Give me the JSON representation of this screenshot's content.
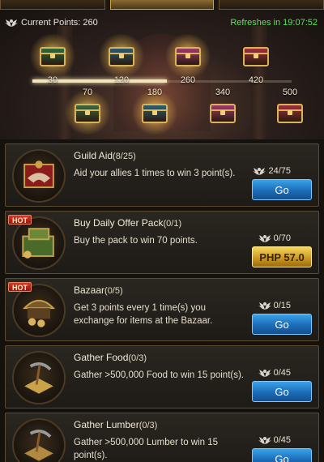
{
  "header": {
    "current_points_label": "Current Points: 260",
    "refresh_label": "Refreshes in 19:07:52"
  },
  "progress": {
    "current": 260,
    "max": 500
  },
  "milestones": [
    {
      "points": "30",
      "color": "#2f6a3a"
    },
    {
      "points": "70",
      "color": "#3a6a40"
    },
    {
      "points": "120",
      "color": "#2a5a70"
    },
    {
      "points": "180",
      "color": "#2a6070"
    },
    {
      "points": "260",
      "color": "#a03a6a"
    },
    {
      "points": "340",
      "color": "#a03a6a"
    },
    {
      "points": "420",
      "color": "#a0303a"
    },
    {
      "points": "500",
      "color": "#a0303a"
    }
  ],
  "tasks": [
    {
      "title": "Guild Aid",
      "count": "(8/25)",
      "description": "Aid your allies 1 times to win 3 point(s).",
      "points": "24/75",
      "button": "Go",
      "hot": false,
      "icon": "handshake-icon"
    },
    {
      "title": "Buy Daily Offer Pack",
      "count": "(0/1)",
      "description": "Buy the pack to win 70 points.",
      "points": "0/70",
      "button": "PHP 57.0",
      "hot": true,
      "icon": "treasure-pack-icon"
    },
    {
      "title": "Bazaar",
      "count": "(0/5)",
      "description": "Get 3 points every 1 time(s) you exchange for items at the Bazaar.",
      "points": "0/15",
      "button": "Go",
      "hot": true,
      "icon": "bazaar-icon"
    },
    {
      "title": "Gather Food",
      "count": "(0/3)",
      "description": "Gather >500,000 Food to win 15 point(s).",
      "points": "0/45",
      "button": "Go",
      "hot": false,
      "icon": "pickaxe-food-icon"
    },
    {
      "title": "Gather Lumber",
      "count": "(0/3)",
      "description": "Gather >500,000 Lumber to win 15 point(s).",
      "points": "0/45",
      "button": "Go",
      "hot": false,
      "icon": "pickaxe-lumber-icon"
    }
  ],
  "hot_label": "HOT"
}
